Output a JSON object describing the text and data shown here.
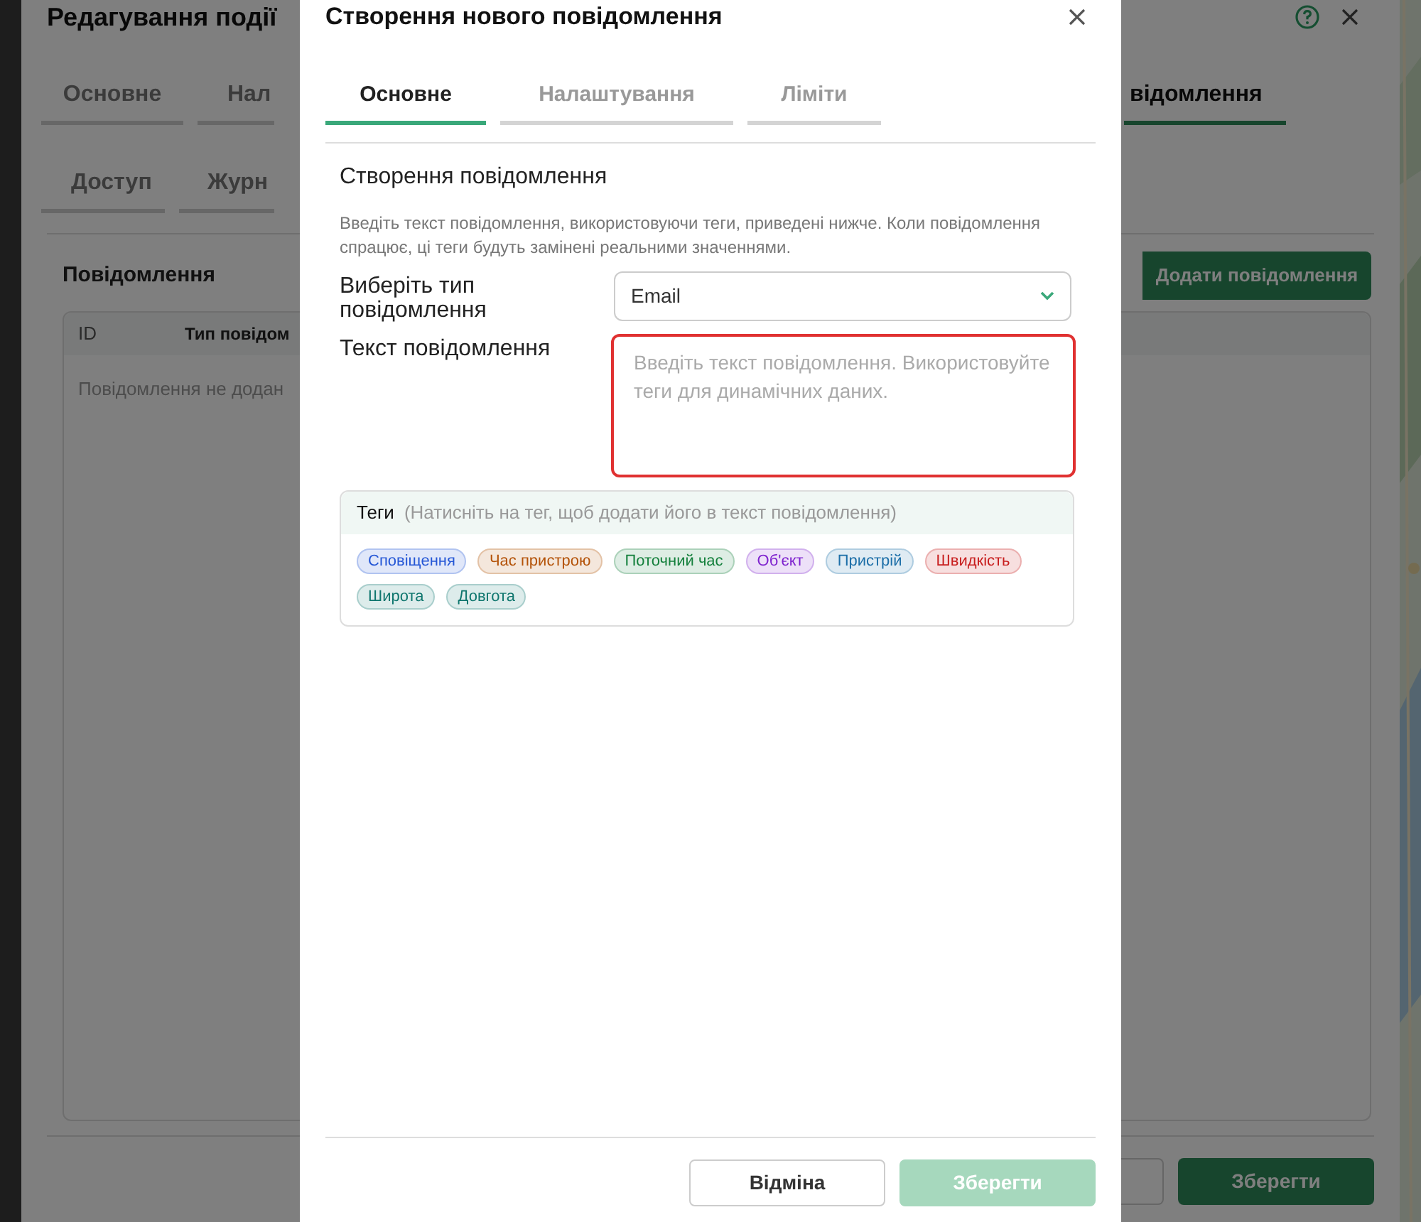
{
  "background_dialog": {
    "title": "Редагування події",
    "tabs_row_1": [
      {
        "label": "Основне",
        "selected": false
      },
      {
        "label": "Нал",
        "selected": false
      },
      {
        "label": "відомлення",
        "selected": true
      }
    ],
    "tabs_row_2": [
      {
        "label": "Доступ",
        "selected": false
      },
      {
        "label": "Журн",
        "selected": false
      }
    ],
    "section_title": "Повідомлення",
    "add_button": "Додати повідомлення",
    "table": {
      "columns": [
        "ID",
        "Тип повідом"
      ],
      "empty_text": "Повідомлення не додан"
    },
    "save_button": "Зберегти"
  },
  "modal": {
    "title": "Створення нового повідомлення",
    "tabs": [
      {
        "label": "Основне",
        "selected": true
      },
      {
        "label": "Налаштування",
        "selected": false
      },
      {
        "label": "Ліміти",
        "selected": false
      }
    ],
    "section_title": "Створення повідомлення",
    "description": "Введіть текст повідомлення, використовуючи теги, приведені нижче. Коли повідомлення спрацює, ці теги будуть замінені реальними значеннями.",
    "fields": [
      {
        "kind": "select",
        "label": "Виберіть тип повідомлення",
        "value": "Email"
      },
      {
        "kind": "textarea",
        "label": "Текст повідомлення",
        "placeholder": "Введіть текст повідомлення. Використовуйте теги для динамічних даних.",
        "error": true
      }
    ],
    "tags": {
      "title": "Теги",
      "hint": "(Натисніть на тег, щоб додати його в текст повідомлення)",
      "items": [
        {
          "label": "Сповіщення",
          "color": "#2557d6"
        },
        {
          "label": "Час пристрою",
          "color": "#b45309"
        },
        {
          "label": "Поточний час",
          "color": "#15803d"
        },
        {
          "label": "Об'єкт",
          "color": "#7e22ce"
        },
        {
          "label": "Пристрій",
          "color": "#1d6fa8"
        },
        {
          "label": "Швидкість",
          "color": "#c81e1e"
        },
        {
          "label": "Широта",
          "color": "#0f766e"
        },
        {
          "label": "Довгота",
          "color": "#0f766e"
        }
      ]
    },
    "buttons": [
      {
        "label": "Відміна",
        "kind": "secondary",
        "disabled": false
      },
      {
        "label": "Зберегти",
        "kind": "primary",
        "disabled": true
      }
    ]
  }
}
